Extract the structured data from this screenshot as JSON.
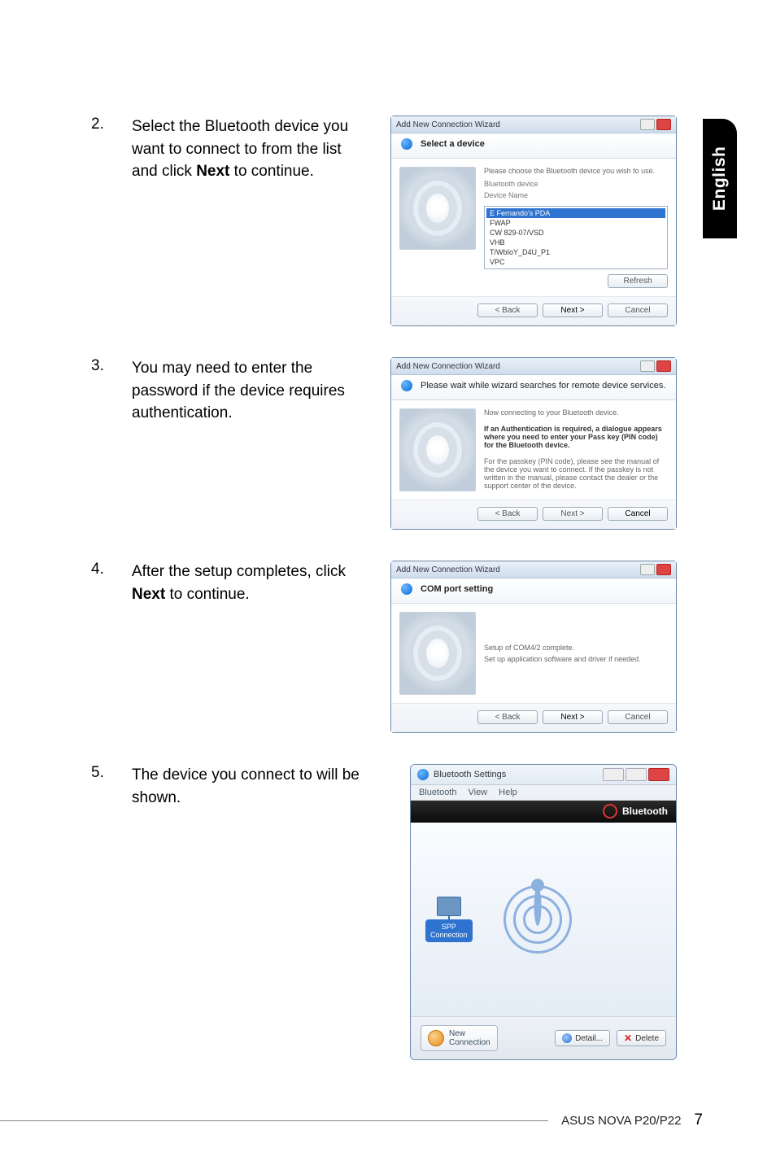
{
  "sideTab": "English",
  "steps": {
    "s2": {
      "num": "2.",
      "text_a": "Select the Bluetooth device you want to connect to from the list and click ",
      "bold": "Next",
      "text_b": " to continue."
    },
    "s3": {
      "num": "3.",
      "text": "You may need to enter the password if the device requires authentication."
    },
    "s4": {
      "num": "4.",
      "text_a": "After the setup completes, click ",
      "bold": "Next",
      "text_b": " to continue."
    },
    "s5": {
      "num": "5.",
      "text": "The device you connect to will be shown."
    }
  },
  "dlg2": {
    "title": "Add New Connection Wizard",
    "heading": "Select a device",
    "prompt": "Please choose the Bluetooth device you wish to use.",
    "listLabel": "Bluetooth device",
    "colLabel": "Device Name",
    "items": {
      "sel": "E Fernando's PDA",
      "i1": "FWAP",
      "i2": "CW 829-07/VSD",
      "i3": "VHB",
      "i4": "T/WbIoY_D4U_P1",
      "i5": "VPC"
    },
    "refresh": "Refresh",
    "back": "< Back",
    "next": "Next >",
    "cancel": "Cancel"
  },
  "dlg3": {
    "title": "Add New Connection Wizard",
    "heading": "Please wait while wizard searches for remote device services.",
    "line1": "Now connecting to your Bluetooth device.",
    "bold": "If an Authentication is required, a dialogue appears where you need to enter your Pass key (PIN code) for the Bluetooth device.",
    "line3": "For the passkey (PIN code), please see the manual of the device you want to connect. If the passkey is not written in the manual, please contact the dealer or the support center of the device.",
    "back": "< Back",
    "next": "Next >",
    "cancel": "Cancel"
  },
  "dlg4": {
    "title": "Add New Connection Wizard",
    "heading": "COM port setting",
    "line1": "Setup of COM4/2 complete.",
    "line2": "Set up application software and driver if needed.",
    "back": "< Back",
    "next": "Next >",
    "cancel": "Cancel"
  },
  "bts": {
    "title": "Bluetooth Settings",
    "menu": {
      "m1": "Bluetooth",
      "m2": "View",
      "m3": "Help"
    },
    "brand": "Bluetooth",
    "deviceLabel": "SPP\nConnection",
    "newConn": "New\nConnection",
    "detail": "Detail...",
    "delete": "Delete"
  },
  "footer": {
    "model": "ASUS NOVA P20/P22",
    "page": "7"
  }
}
